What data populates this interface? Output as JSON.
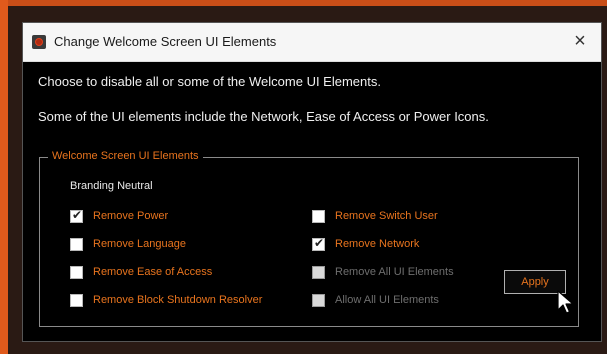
{
  "window": {
    "title": "Change Welcome Screen UI Elements",
    "close_label": "×",
    "icon": "app-icon"
  },
  "description": {
    "line1": "Choose to disable all or some of the Welcome UI Elements.",
    "line2": "Some of the UI elements include the Network, Ease of Access or Power Icons."
  },
  "group": {
    "title": "Welcome Screen UI Elements",
    "branding_label": "Branding Neutral",
    "options": {
      "remove_power": {
        "label": "Remove Power",
        "checked": true,
        "enabled": true
      },
      "remove_language": {
        "label": "Remove Language",
        "checked": false,
        "enabled": true
      },
      "remove_ease": {
        "label": "Remove Ease of Access",
        "checked": false,
        "enabled": true
      },
      "remove_block_shutdown": {
        "label": "Remove Block Shutdown Resolver",
        "checked": false,
        "enabled": true
      },
      "remove_switch_user": {
        "label": "Remove Switch User",
        "checked": false,
        "enabled": true
      },
      "remove_network": {
        "label": "Remove Network",
        "checked": true,
        "enabled": true
      },
      "remove_all": {
        "label": "Remove All UI Elements",
        "checked": false,
        "enabled": false
      },
      "allow_all": {
        "label": "Allow All UI Elements",
        "checked": false,
        "enabled": false
      }
    },
    "apply_label": "Apply"
  },
  "colors": {
    "accent": "#e8741e",
    "frame": "#e05a1c",
    "window_bg": "#000000",
    "titlebar_bg": "#f6f6f6",
    "disabled_text": "#6e6e6e"
  }
}
